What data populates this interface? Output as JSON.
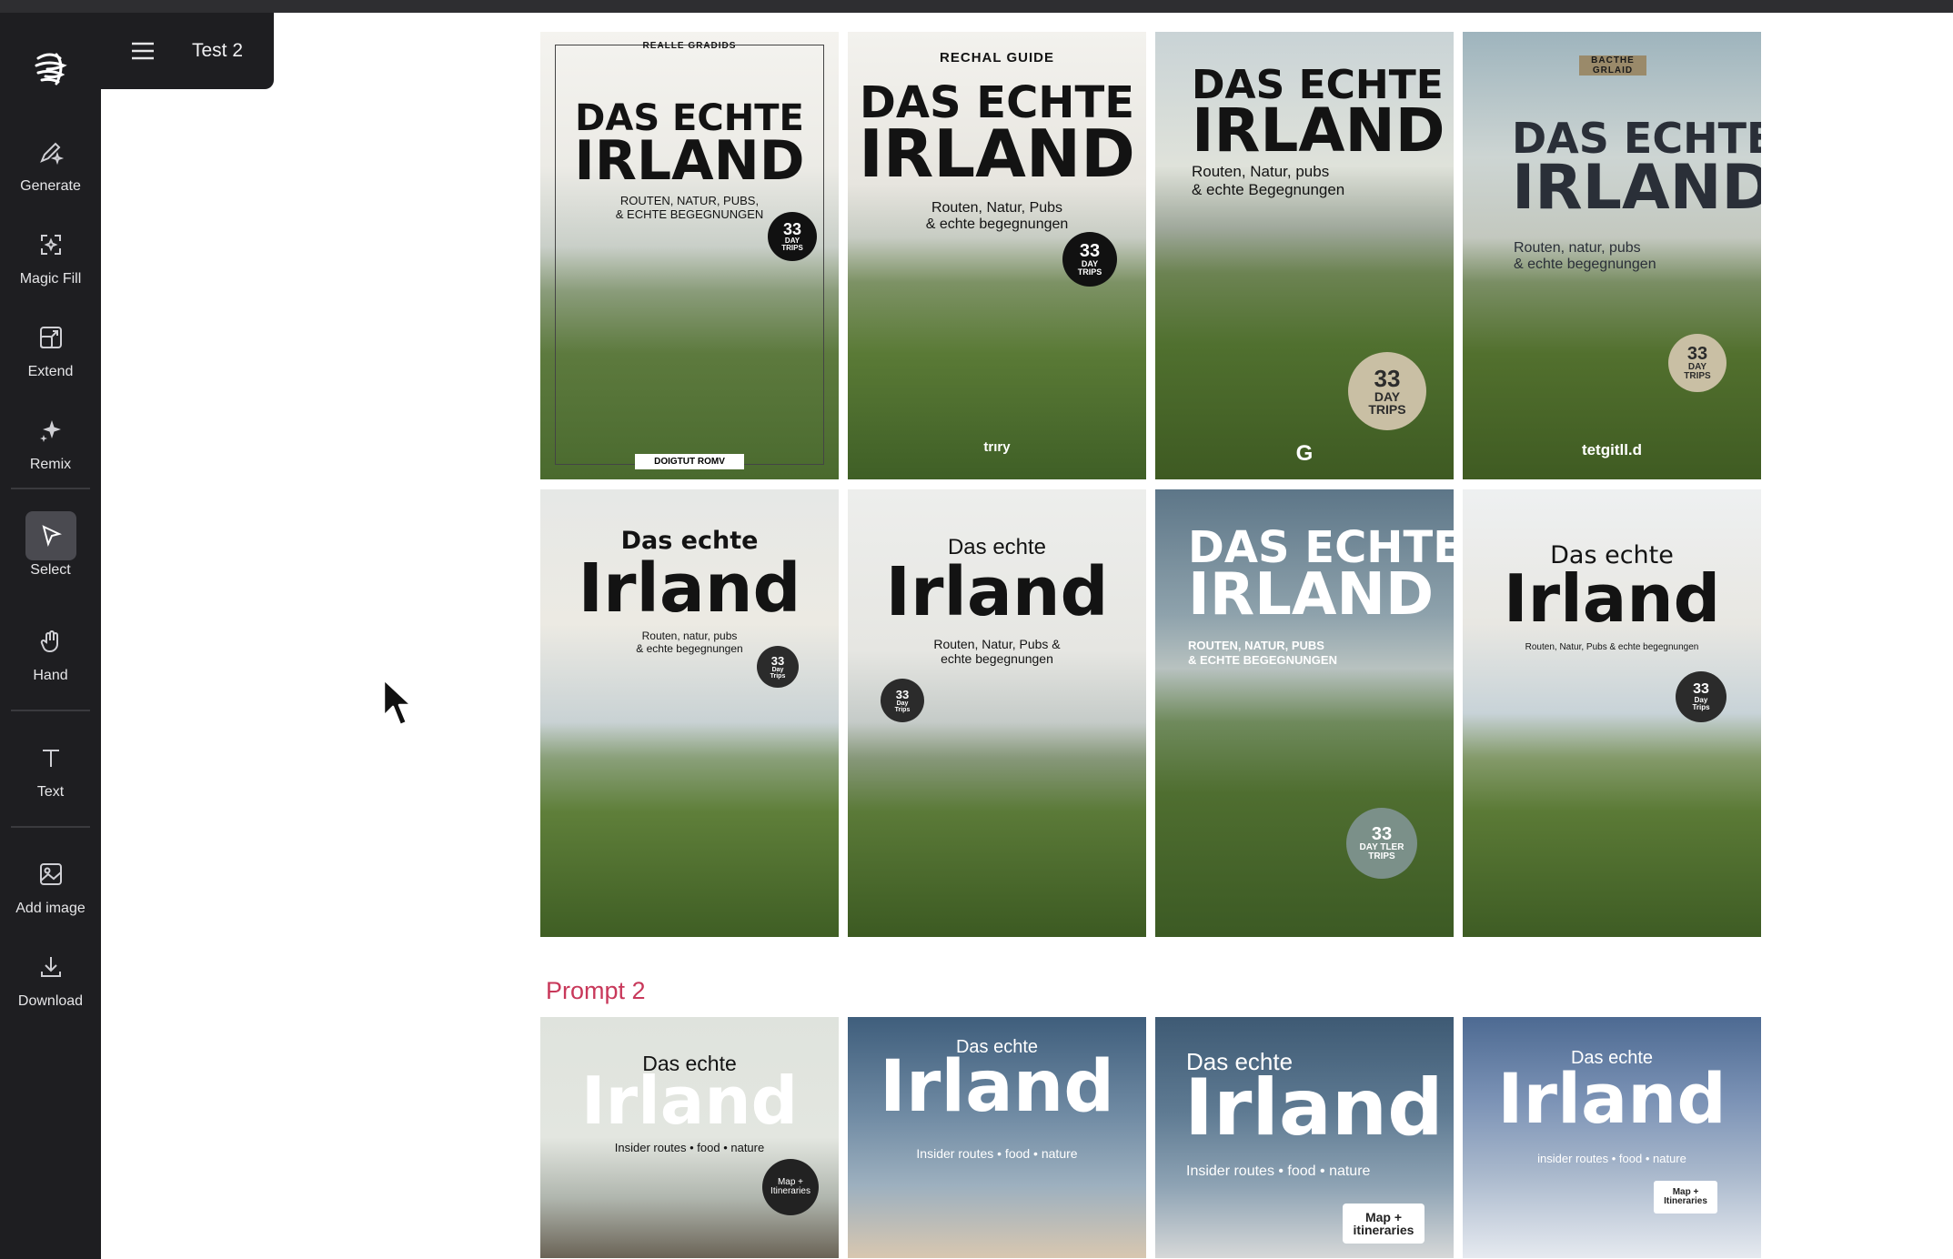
{
  "app": {
    "project_title": "Test 2"
  },
  "tools": [
    {
      "label": "Generate",
      "icon": "pencil-sparkle-icon"
    },
    {
      "label": "Magic Fill",
      "icon": "magic-fill-icon"
    },
    {
      "label": "Extend",
      "icon": "extend-icon"
    },
    {
      "label": "Remix",
      "icon": "sparkle-icon"
    },
    {
      "label": "Select",
      "icon": "pointer-icon",
      "active": true
    },
    {
      "label": "Hand",
      "icon": "hand-icon"
    },
    {
      "label": "Text",
      "icon": "text-icon"
    },
    {
      "label": "Add image",
      "icon": "image-icon"
    },
    {
      "label": "Download",
      "icon": "download-icon"
    }
  ],
  "prompt2_label": "Prompt 2",
  "row1": [
    {
      "kicker": "REALLE GRADIDS",
      "title1": "DAS ECHTE",
      "title2": "IRLAND",
      "sub1": "ROUTEN, NATUR, PUBS,",
      "sub2": "& ECHTE BEGEGNUNGEN",
      "badge_num": "33",
      "badge_txt": "DAY TRIPS",
      "footer": "DOIGTUT ROMV"
    },
    {
      "kicker": "RECHAL GUIDE",
      "title1": "DAS ECHTE",
      "title2": "IRLAND",
      "sub1": "Routen, Natur, Pubs",
      "sub2": "& echte begegnungen",
      "badge_num": "33",
      "badge_txt": "DAY TRIPS",
      "footer": "trıry"
    },
    {
      "kicker": "",
      "title1": "DAS ECHTE",
      "title2": "IRLAND",
      "sub1": "Routen, Natur, pubs",
      "sub2": "& echte Begegnungen",
      "badge_num": "33",
      "badge_txt": "DAY TRIPS",
      "footer": "G"
    },
    {
      "kicker": "BACTHE GRLAID",
      "title1": "DAS ECHTE",
      "title2": "IRLAND",
      "sub1": "Routen, natur, pubs",
      "sub2": "& echte begegnungen",
      "badge_num": "33",
      "badge_txt": "DAY TRIPS",
      "footer": "tetgitll.d"
    }
  ],
  "row2": [
    {
      "title1": "Das echte",
      "title2": "Irland",
      "sub1": "Routen, natur, pubs",
      "sub2": "& echte begegnungen",
      "badge_num": "33",
      "badge_txt": "Day Trips"
    },
    {
      "title1": "Das echte",
      "title2": "Irland",
      "sub1": "Routen, Natur, Pubs &",
      "sub2": "echte begegnungen",
      "badge_num": "33",
      "badge_txt": "Day Trips"
    },
    {
      "title1": "DAS ECHTE",
      "title2": "IRLAND",
      "sub1": "ROUTEN, NATUR, PUBS",
      "sub2": "& ECHTE BEGEGNUNGEN",
      "badge_num": "33",
      "badge_txt": "DAY TLER TRIPS"
    },
    {
      "title1": "Das echte",
      "title2": "Irland",
      "sub1": "Routen, Natur, Pubs & echte begegnungen",
      "sub2": "",
      "badge_num": "33",
      "badge_txt": "Day Trips"
    }
  ],
  "row3": [
    {
      "title1": "Das echte",
      "title2": "Irland",
      "sub1": "Insider routes • food • nature",
      "badge": "Map + Itineraries"
    },
    {
      "title1": "Das echte",
      "title2": "Irland",
      "sub1": "Insider routes • food • nature",
      "badge": ""
    },
    {
      "title1": "Das echte",
      "title2": "Irland",
      "sub1": "Insider routes • food • nature",
      "badge": "Map + itineraries"
    },
    {
      "title1": "Das echte",
      "title2": "Irland",
      "sub1": "insider routes • food • nature",
      "badge": "Map + Itineraries"
    }
  ]
}
